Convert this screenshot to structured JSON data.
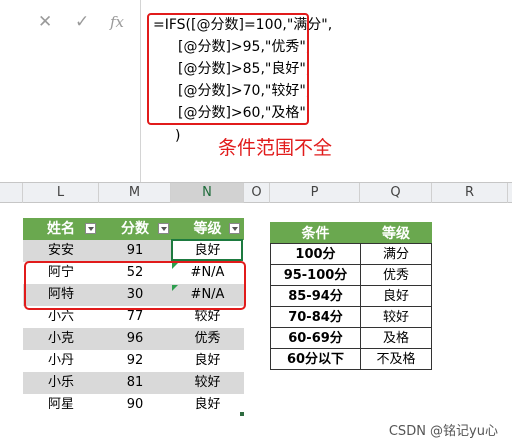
{
  "formula_bar": {
    "cancel_icon": "✕",
    "confirm_icon": "✓",
    "fx_label": "fx",
    "lines": [
      "=IFS([@分数]=100,\"满分\",",
      "[@分数]>95,\"优秀\",",
      "[@分数]>85,\"良好\",",
      "[@分数]>70,\"较好\",",
      "[@分数]>60,\"及格\"",
      ")"
    ],
    "annotation": "条件范围不全"
  },
  "column_headers": [
    "L",
    "M",
    "N",
    "O",
    "P",
    "Q",
    "R"
  ],
  "score_table": {
    "headers": [
      "姓名",
      "分数",
      "等级"
    ],
    "rows": [
      [
        "安安",
        "91",
        "良好"
      ],
      [
        "阿宁",
        "52",
        "#N/A"
      ],
      [
        "阿特",
        "30",
        "#N/A"
      ],
      [
        "小六",
        "77",
        "较好"
      ],
      [
        "小克",
        "96",
        "优秀"
      ],
      [
        "小丹",
        "92",
        "良好"
      ],
      [
        "小乐",
        "81",
        "较好"
      ],
      [
        "阿星",
        "90",
        "良好"
      ]
    ]
  },
  "criteria_table": {
    "headers": [
      "条件",
      "等级"
    ],
    "rows": [
      [
        "100分",
        "满分"
      ],
      [
        "95-100分",
        "优秀"
      ],
      [
        "85-94分",
        "良好"
      ],
      [
        "70-84分",
        "较好"
      ],
      [
        "60-69分",
        "及格"
      ],
      [
        "60分以下",
        "不及格"
      ]
    ]
  },
  "watermark": "CSDN @铭记yu心",
  "colors": {
    "header_green": "#6aa84f",
    "highlight_red": "#e11b1b",
    "band_gray": "#d9d9d9"
  }
}
